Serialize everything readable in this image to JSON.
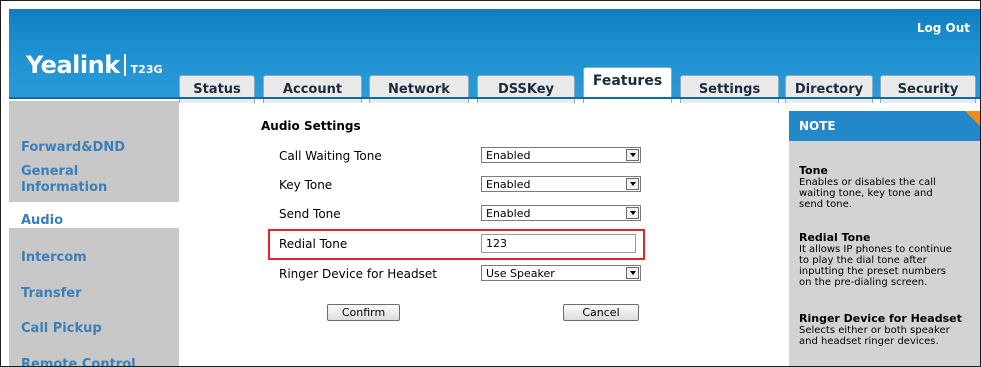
{
  "header": {
    "logo_brand": "Yealink",
    "logo_model": "T23G",
    "logout": "Log Out",
    "tabs": [
      "Status",
      "Account",
      "Network",
      "DSSKey",
      "Features",
      "Settings",
      "Directory",
      "Security"
    ],
    "active_tab": "Features"
  },
  "sidebar": {
    "items": [
      "Forward&DND",
      "General Information",
      "Audio",
      "Intercom",
      "Transfer",
      "Call Pickup",
      "Remote Control"
    ],
    "general_line1": "General",
    "general_line2": "Information",
    "active_item": "Audio"
  },
  "main": {
    "section_title": "Audio Settings",
    "rows": {
      "call_waiting_tone": {
        "label": "Call Waiting Tone",
        "value": "Enabled"
      },
      "key_tone": {
        "label": "Key Tone",
        "value": "Enabled"
      },
      "send_tone": {
        "label": "Send Tone",
        "value": "Enabled"
      },
      "redial_tone": {
        "label": "Redial Tone",
        "value": "123"
      },
      "ringer_device": {
        "label": "Ringer Device for Headset",
        "value": "Use Speaker"
      }
    },
    "confirm_label": "Confirm",
    "cancel_label": "Cancel",
    "highlight_color": "#e0262a"
  },
  "note": {
    "title": "NOTE",
    "sections": [
      {
        "heading": "Tone",
        "lines": [
          "Enables or disables the call",
          "waiting tone, key tone and",
          "send tone."
        ]
      },
      {
        "heading": "Redial Tone",
        "lines": [
          "It allows IP phones to continue",
          "to play the dial tone after",
          "inputting the preset numbers",
          "on the pre-dialing screen."
        ]
      },
      {
        "heading": "Ringer Device for Headset",
        "lines": [
          "Selects either or both speaker",
          "and headset ringer devices."
        ]
      }
    ]
  },
  "colors": {
    "header_blue": "#1c8fd0",
    "sidebar_gray": "#c8c8c8",
    "link_blue": "#3a7fb7",
    "note_accent": "#f08a1c"
  }
}
